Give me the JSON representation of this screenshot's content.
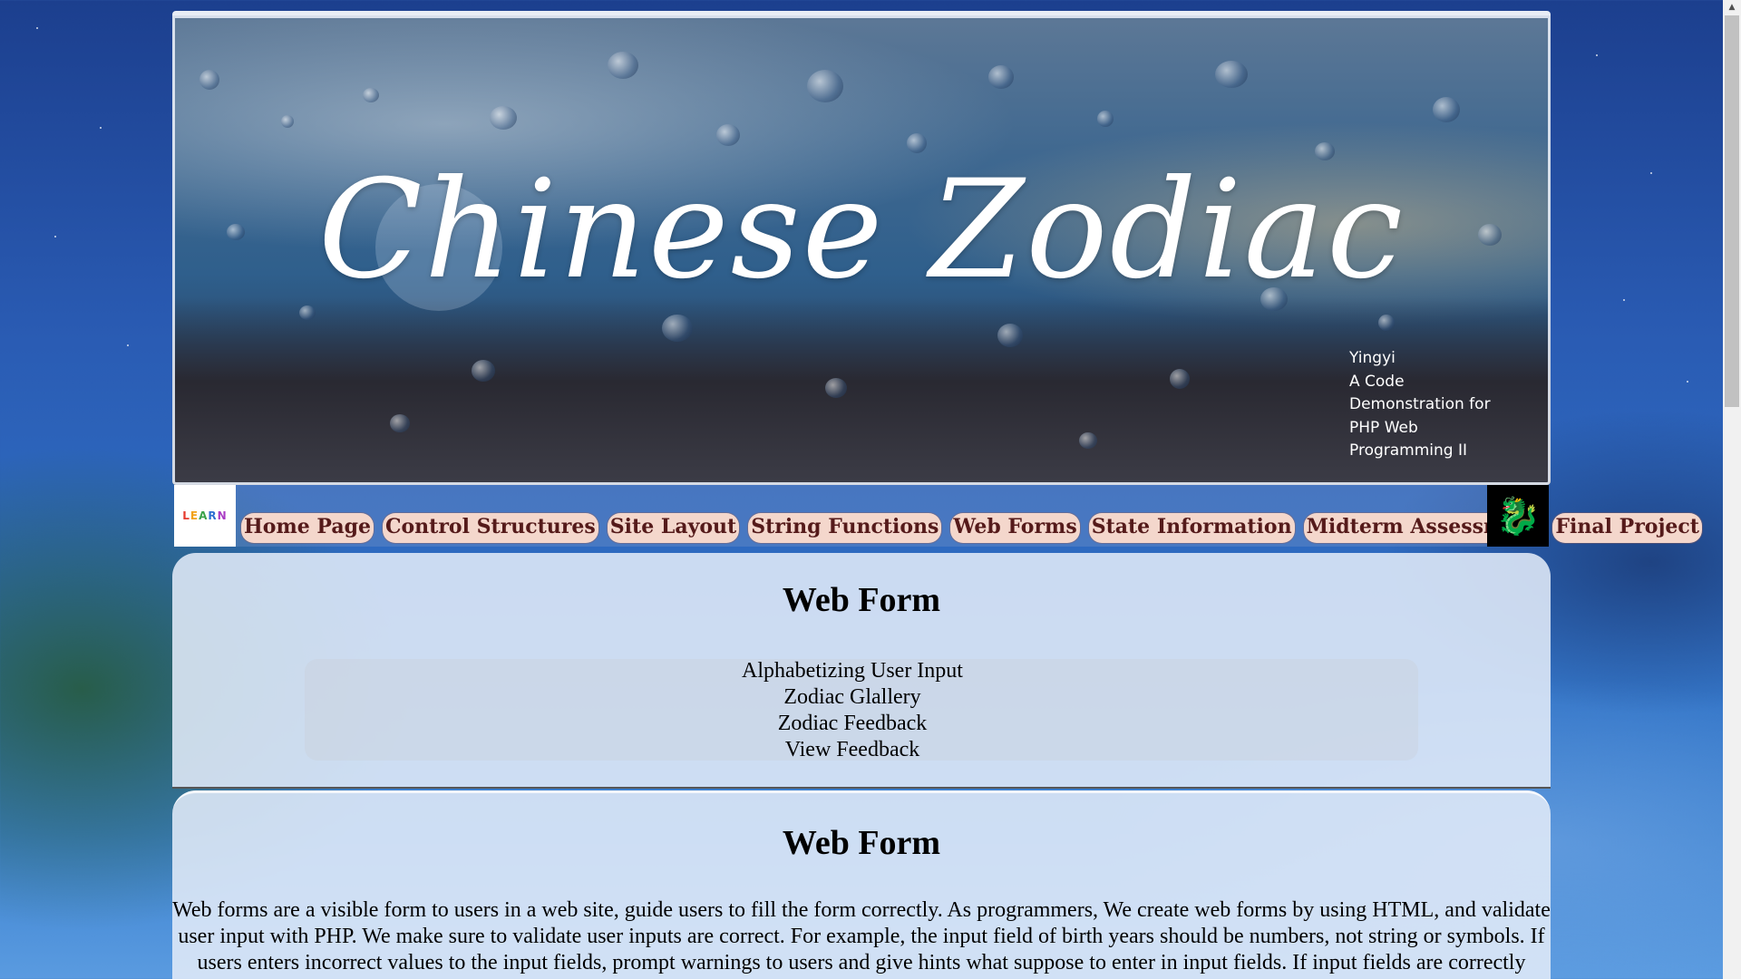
{
  "banner": {
    "title": "Chinese Zodiac",
    "credit_lines": [
      "Yingyi",
      "A Code",
      "Demonstration for",
      "PHP Web",
      "Programming II"
    ]
  },
  "nav": {
    "logo_left_text": "LEARN",
    "items": [
      {
        "label": "Home Page"
      },
      {
        "label": "Control Structures"
      },
      {
        "label": "Site Layout"
      },
      {
        "label": "String Functions"
      },
      {
        "label": "Web Forms"
      },
      {
        "label": "State Information"
      },
      {
        "label": "Midterm Assessment"
      },
      {
        "label": "Final Project"
      }
    ]
  },
  "links_panel": {
    "title": "Web Form",
    "links": [
      "Alphabetizing User Input",
      "Zodiac Glallery",
      "Zodiac Feedback",
      "View Feedback"
    ]
  },
  "info_panel": {
    "title": "Web Form",
    "text": "Web forms are a visible form to users in a web site, guide users to fill the form correctly. As programmers, We create web forms by using HTML, and validate user input with PHP. We make sure to validate user inputs are correct. For example, the input field of birth years should be numbers, not string or symbols. If users enters incorrect values to the input fields, prompt warnings to users and give hints what suppose to enter in input fields. If input fields are correctly entered, then display results to users or submit to the web server database."
  },
  "colors": {
    "nav_button_bg": "#f4d7cc",
    "nav_button_text": "#551a1a",
    "panel_bg": "#e1ebf8"
  },
  "icons": {
    "left_logo": "learn-logo-icon",
    "right_logo": "dragon-icon",
    "scroll_up": "chevron-up-icon"
  }
}
